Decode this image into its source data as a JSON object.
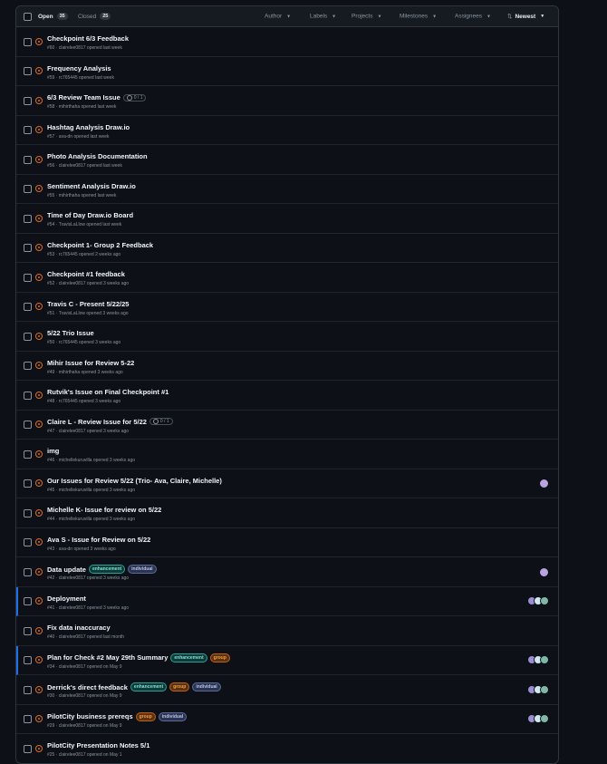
{
  "header": {
    "open_label": "Open",
    "open_count": "35",
    "closed_label": "Closed",
    "closed_count": "25",
    "filters": [
      "Author",
      "Labels",
      "Projects",
      "Milestones",
      "Assignees"
    ],
    "sort_label": "Newest"
  },
  "issues": [
    {
      "title": "Checkpoint 6/3 Feedback",
      "meta": "#60 · clairelee0817 opened last week",
      "labels": [],
      "task": "",
      "avatars": 0
    },
    {
      "title": "Frequency Analysis",
      "meta": "#59 · rc765445 opened last week",
      "labels": [],
      "task": "",
      "avatars": 0
    },
    {
      "title": "6/3 Review Team Issue",
      "meta": "#58 · mihirthaha opened last week",
      "labels": [],
      "task": "0 / 1",
      "avatars": 0
    },
    {
      "title": "Hashtag Analysis Draw.io",
      "meta": "#57 · ava-dn opened last week",
      "labels": [],
      "task": "",
      "avatars": 0
    },
    {
      "title": "Photo Analysis Documentation",
      "meta": "#56 · clairelee0817 opened last week",
      "labels": [],
      "task": "",
      "avatars": 0
    },
    {
      "title": "Sentiment Analysis Draw.io",
      "meta": "#55 · mihirthaha opened last week",
      "labels": [],
      "task": "",
      "avatars": 0
    },
    {
      "title": "Time of Day Draw.io Board",
      "meta": "#54 · TravisLaLlow opened last week",
      "labels": [],
      "task": "",
      "avatars": 0
    },
    {
      "title": "Checkpoint 1- Group 2 Feedback",
      "meta": "#53 · rc765445 opened 2 weeks ago",
      "labels": [],
      "task": "",
      "avatars": 0
    },
    {
      "title": "Checkpoint #1 feedback",
      "meta": "#52 · clairelee0817 opened 3 weeks ago",
      "labels": [],
      "task": "",
      "avatars": 0
    },
    {
      "title": "Travis C - Present 5/22/25",
      "meta": "#51 · TravisLaLlow opened 3 weeks ago",
      "labels": [],
      "task": "",
      "avatars": 0
    },
    {
      "title": "5/22 Trio Issue",
      "meta": "#50 · rc765445 opened 3 weeks ago",
      "labels": [],
      "task": "",
      "avatars": 0
    },
    {
      "title": "Mihir Issue for Review 5-22",
      "meta": "#49 · mihirthaha opened 3 weeks ago",
      "labels": [],
      "task": "",
      "avatars": 0
    },
    {
      "title": "Rutvik's Issue on Final Checkpoint #1",
      "meta": "#48 · rc765445 opened 3 weeks ago",
      "labels": [],
      "task": "",
      "avatars": 0
    },
    {
      "title": "Claire L - Review Issue for 5/22",
      "meta": "#47 · clairelee0817 opened 3 weeks ago",
      "labels": [],
      "task": "0 / 1",
      "avatars": 0
    },
    {
      "title": "img",
      "meta": "#46 · michellekuruvilla opened 3 weeks ago",
      "labels": [],
      "task": "",
      "avatars": 0
    },
    {
      "title": "Our Issues for Review 5/22 (Trio- Ava, Claire, Michelle)",
      "meta": "#45 · michellekuruvilla opened 3 weeks ago",
      "labels": [],
      "task": "",
      "avatars": 1
    },
    {
      "title": "Michelle K- Issue for review on 5/22",
      "meta": "#44 · michellekuruvilla opened 3 weeks ago",
      "labels": [],
      "task": "",
      "avatars": 0
    },
    {
      "title": "Ava S - Issue for Review on 5/22",
      "meta": "#43 · ava-dn opened 3 weeks ago",
      "labels": [],
      "task": "",
      "avatars": 0
    },
    {
      "title": "Data update",
      "meta": "#42 · clairelee0817 opened 3 weeks ago",
      "labels": [
        "enhancement",
        "individual"
      ],
      "task": "",
      "avatars": 1
    },
    {
      "title": "Deployment",
      "meta": "#41 · clairelee0817 opened 3 weeks ago",
      "labels": [],
      "task": "",
      "avatars": 3,
      "highlight": true
    },
    {
      "title": "Fix data inaccuracy",
      "meta": "#40 · clairelee0817 opened last month",
      "labels": [],
      "task": "",
      "avatars": 0
    },
    {
      "title": "Plan for Check #2 May 29th Summary",
      "meta": "#34 · clairelee0817 opened on May 9",
      "labels": [
        "enhancement",
        "group"
      ],
      "task": "",
      "avatars": 3,
      "highlight": true
    },
    {
      "title": "Derrick's direct feedback",
      "meta": "#30 · clairelee0817 opened on May 9",
      "labels": [
        "enhancement",
        "group",
        "individual"
      ],
      "task": "",
      "avatars": 3
    },
    {
      "title": "PilotCity business prereqs",
      "meta": "#29 · clairelee0817 opened on May 9",
      "labels": [
        "group",
        "individual"
      ],
      "task": "",
      "avatars": 3
    },
    {
      "title": "PilotCity Presentation Notes 5/1",
      "meta": "#25 · clairelee0817 opened on May 1",
      "labels": [],
      "task": "",
      "avatars": 0
    }
  ]
}
